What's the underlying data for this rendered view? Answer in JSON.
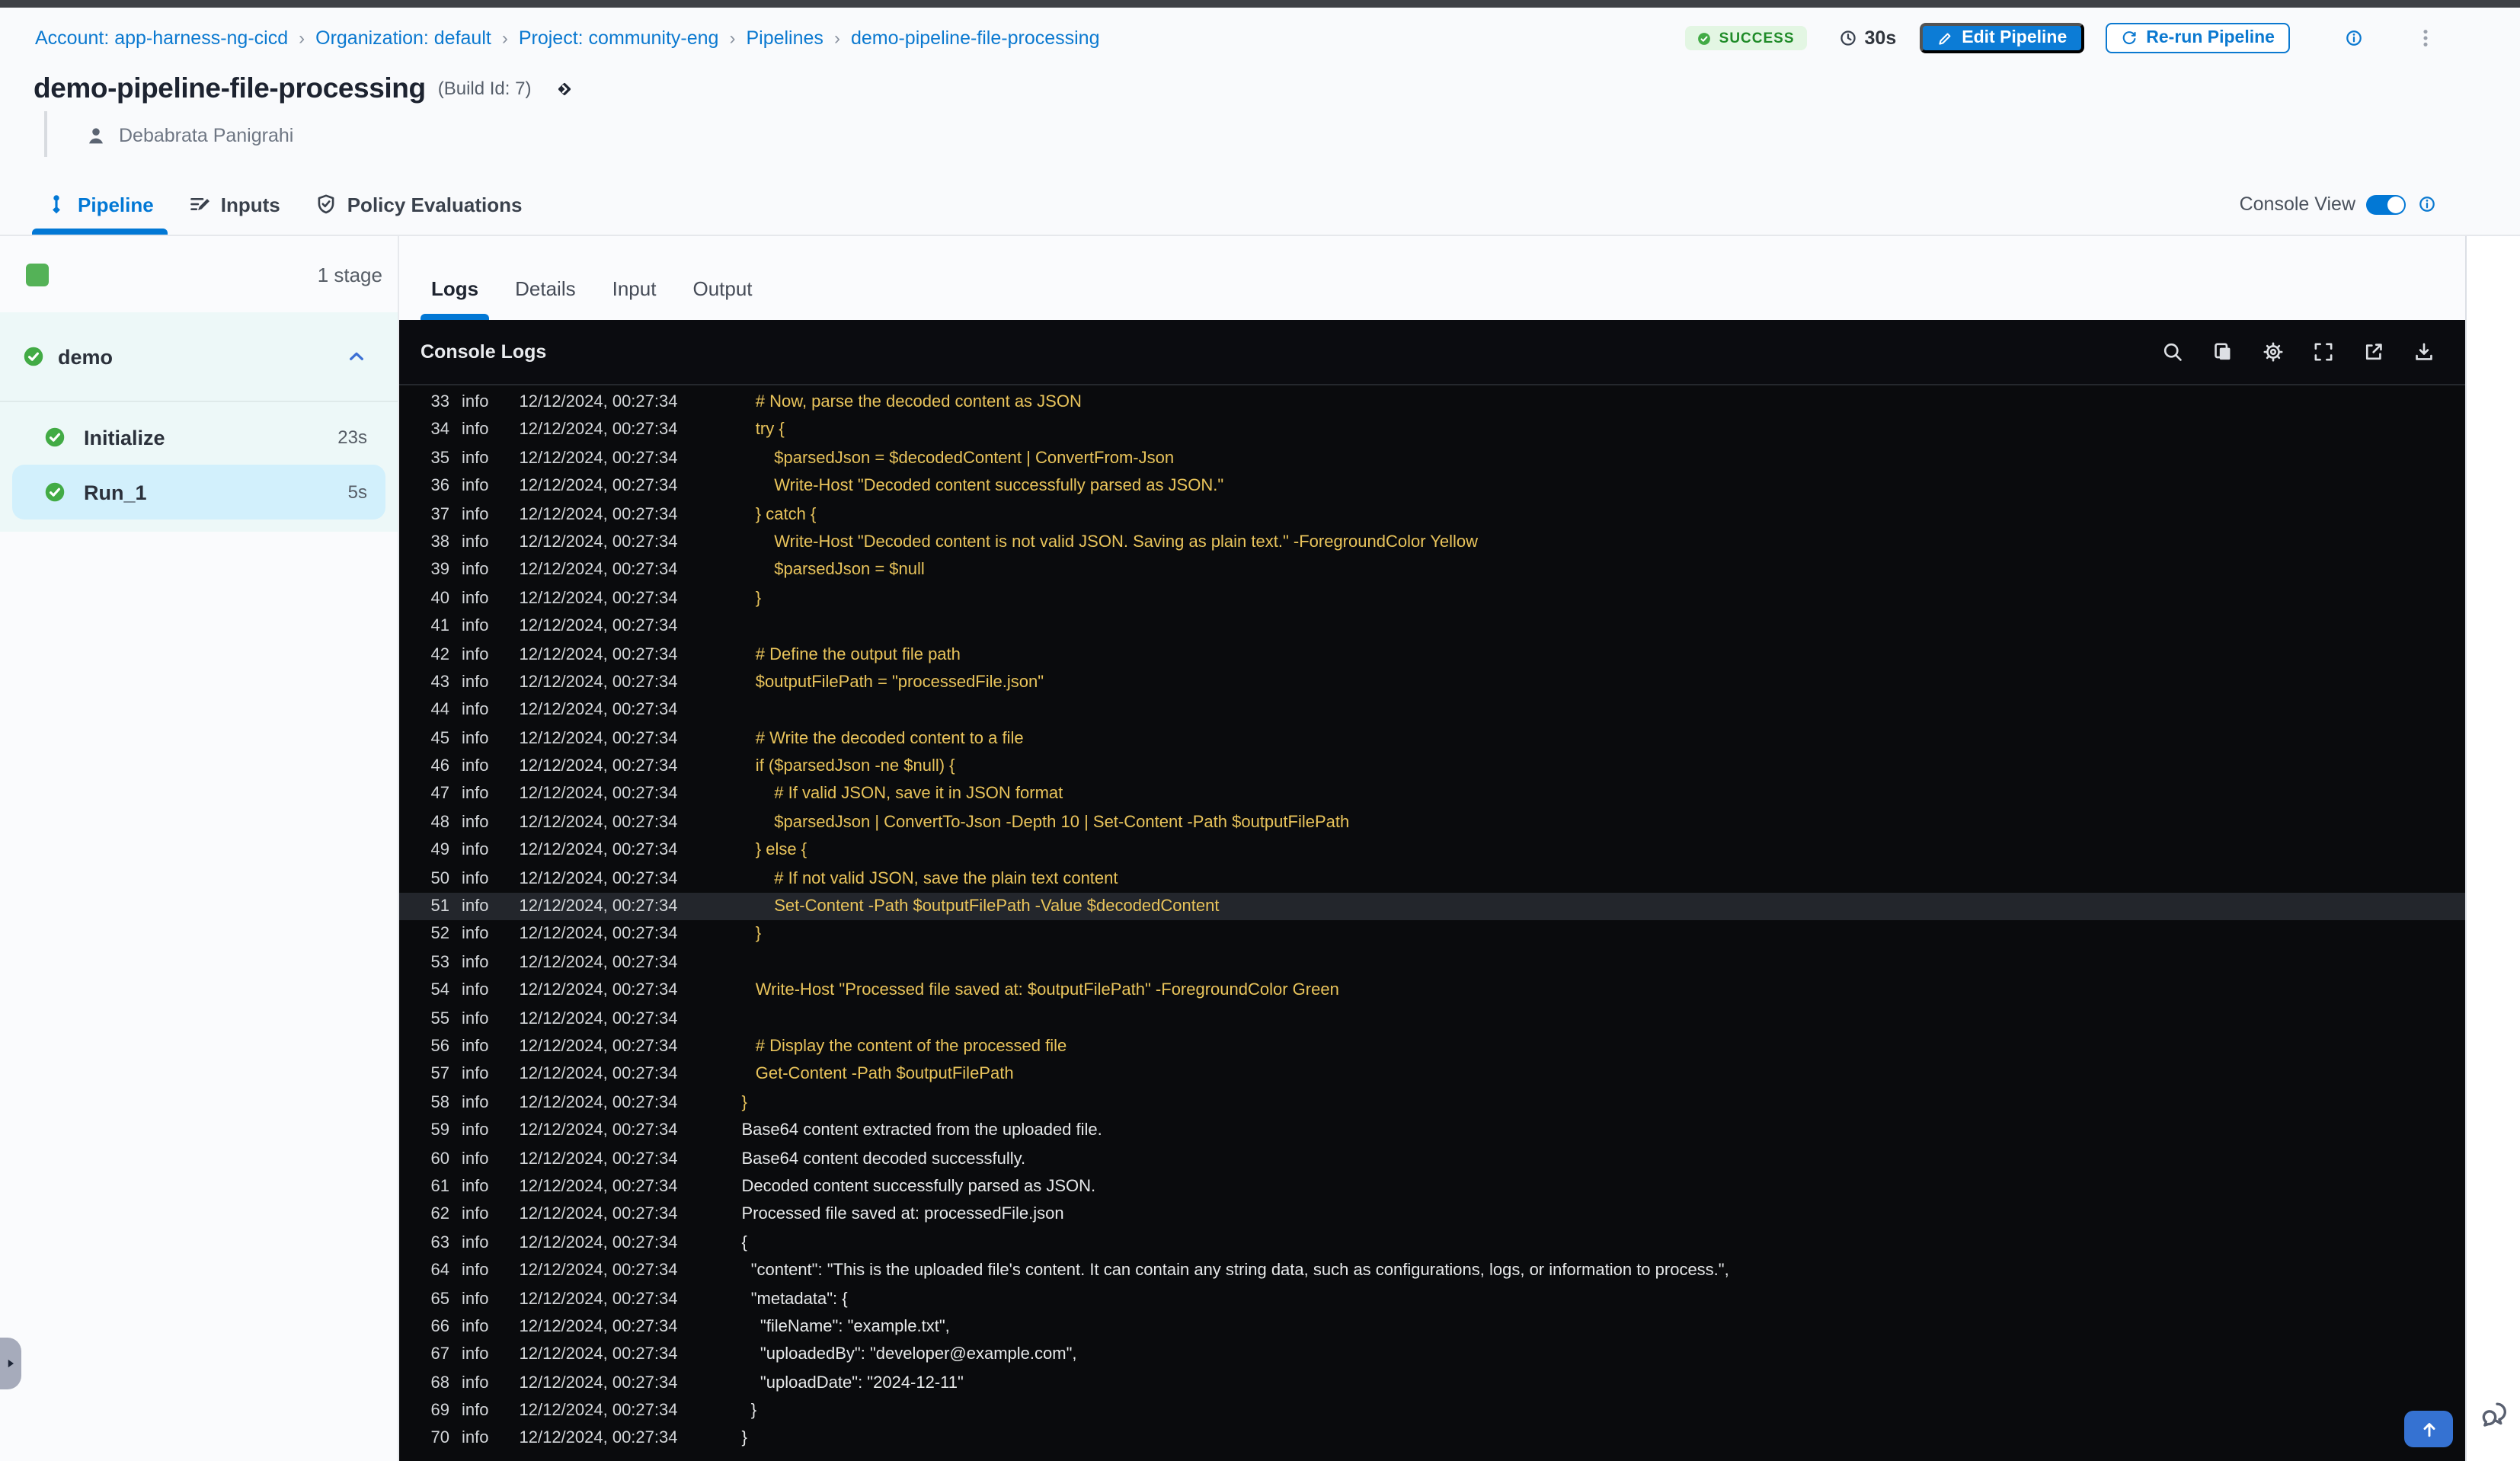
{
  "colors": {
    "accent_blue": "#0278d5",
    "success_green": "#42ab45",
    "log_yellow": "#e9c45b",
    "console_bg": "#0a0b0d"
  },
  "breadcrumb": {
    "separator": "›",
    "items": [
      "Account: app-harness-ng-cicd",
      "Organization: default",
      "Project: community-eng",
      "Pipelines",
      "demo-pipeline-file-processing"
    ]
  },
  "header": {
    "status_badge": "SUCCESS",
    "duration": "30s",
    "edit_button": "Edit Pipeline",
    "rerun_button": "Re-run Pipeline",
    "title": "demo-pipeline-file-processing",
    "build_id": "(Build Id: 7)",
    "author": "Debabrata Panigrahi"
  },
  "tabs": {
    "items": [
      {
        "label": "Pipeline",
        "icon": "pipeline",
        "active": true
      },
      {
        "label": "Inputs",
        "icon": "inputs",
        "active": false
      },
      {
        "label": "Policy Evaluations",
        "icon": "shield-check",
        "active": false
      }
    ],
    "console_view": {
      "label": "Console View",
      "enabled": true
    }
  },
  "sidebar": {
    "stage_count": "1 stage",
    "group": {
      "name": "demo",
      "status": "success"
    },
    "steps": [
      {
        "name": "Initialize",
        "duration": "23s",
        "status": "success",
        "selected": false
      },
      {
        "name": "Run_1",
        "duration": "5s",
        "status": "success",
        "selected": true
      }
    ]
  },
  "log_tabs": {
    "active": "Logs",
    "items": [
      "Logs",
      "Details",
      "Input",
      "Output"
    ]
  },
  "console": {
    "title": "Console Logs",
    "toolbar_icons": [
      "search",
      "copy",
      "settings",
      "fullscreen",
      "open-in-new",
      "download"
    ],
    "line_level": "info",
    "line_timestamp": "12/12/2024, 00:27:34",
    "lines": [
      {
        "n": 33,
        "tone": "script",
        "text": "   # Now, parse the decoded content as JSON"
      },
      {
        "n": 34,
        "tone": "script",
        "text": "   try {"
      },
      {
        "n": 35,
        "tone": "script",
        "text": "       $parsedJson = $decodedContent | ConvertFrom-Json"
      },
      {
        "n": 36,
        "tone": "script",
        "text": "       Write-Host \"Decoded content successfully parsed as JSON.\""
      },
      {
        "n": 37,
        "tone": "script",
        "text": "   } catch {"
      },
      {
        "n": 38,
        "tone": "script",
        "text": "       Write-Host \"Decoded content is not valid JSON. Saving as plain text.\" -ForegroundColor Yellow"
      },
      {
        "n": 39,
        "tone": "script",
        "text": "       $parsedJson = $null"
      },
      {
        "n": 40,
        "tone": "script",
        "text": "   }"
      },
      {
        "n": 41,
        "tone": "script",
        "text": ""
      },
      {
        "n": 42,
        "tone": "script",
        "text": "   # Define the output file path"
      },
      {
        "n": 43,
        "tone": "script",
        "text": "   $outputFilePath = \"processedFile.json\""
      },
      {
        "n": 44,
        "tone": "script",
        "text": ""
      },
      {
        "n": 45,
        "tone": "script",
        "text": "   # Write the decoded content to a file"
      },
      {
        "n": 46,
        "tone": "script",
        "text": "   if ($parsedJson -ne $null) {"
      },
      {
        "n": 47,
        "tone": "script",
        "text": "       # If valid JSON, save it in JSON format"
      },
      {
        "n": 48,
        "tone": "script",
        "text": "       $parsedJson | ConvertTo-Json -Depth 10 | Set-Content -Path $outputFilePath"
      },
      {
        "n": 49,
        "tone": "script",
        "text": "   } else {"
      },
      {
        "n": 50,
        "tone": "script",
        "text": "       # If not valid JSON, save the plain text content"
      },
      {
        "n": 51,
        "tone": "script",
        "text": "       Set-Content -Path $outputFilePath -Value $decodedContent",
        "highlight": true
      },
      {
        "n": 52,
        "tone": "script",
        "text": "   }"
      },
      {
        "n": 53,
        "tone": "script",
        "text": ""
      },
      {
        "n": 54,
        "tone": "script",
        "text": "   Write-Host \"Processed file saved at: $outputFilePath\" -ForegroundColor Green"
      },
      {
        "n": 55,
        "tone": "script",
        "text": ""
      },
      {
        "n": 56,
        "tone": "script",
        "text": "   # Display the content of the processed file"
      },
      {
        "n": 57,
        "tone": "script",
        "text": "   Get-Content -Path $outputFilePath"
      },
      {
        "n": 58,
        "tone": "script",
        "text": "}"
      },
      {
        "n": 59,
        "tone": "output",
        "text": "Base64 content extracted from the uploaded file."
      },
      {
        "n": 60,
        "tone": "output",
        "text": "Base64 content decoded successfully."
      },
      {
        "n": 61,
        "tone": "output",
        "text": "Decoded content successfully parsed as JSON."
      },
      {
        "n": 62,
        "tone": "output",
        "text": "Processed file saved at: processedFile.json"
      },
      {
        "n": 63,
        "tone": "output",
        "text": "{"
      },
      {
        "n": 64,
        "tone": "output",
        "text": "  \"content\": \"This is the uploaded file's content. It can contain any string data, such as configurations, logs, or information to process.\","
      },
      {
        "n": 65,
        "tone": "output",
        "text": "  \"metadata\": {"
      },
      {
        "n": 66,
        "tone": "output",
        "text": "    \"fileName\": \"example.txt\","
      },
      {
        "n": 67,
        "tone": "output",
        "text": "    \"uploadedBy\": \"developer@example.com\","
      },
      {
        "n": 68,
        "tone": "output",
        "text": "    \"uploadDate\": \"2024-12-11\""
      },
      {
        "n": 69,
        "tone": "output",
        "text": "  }"
      },
      {
        "n": 70,
        "tone": "output",
        "text": "}"
      }
    ]
  }
}
